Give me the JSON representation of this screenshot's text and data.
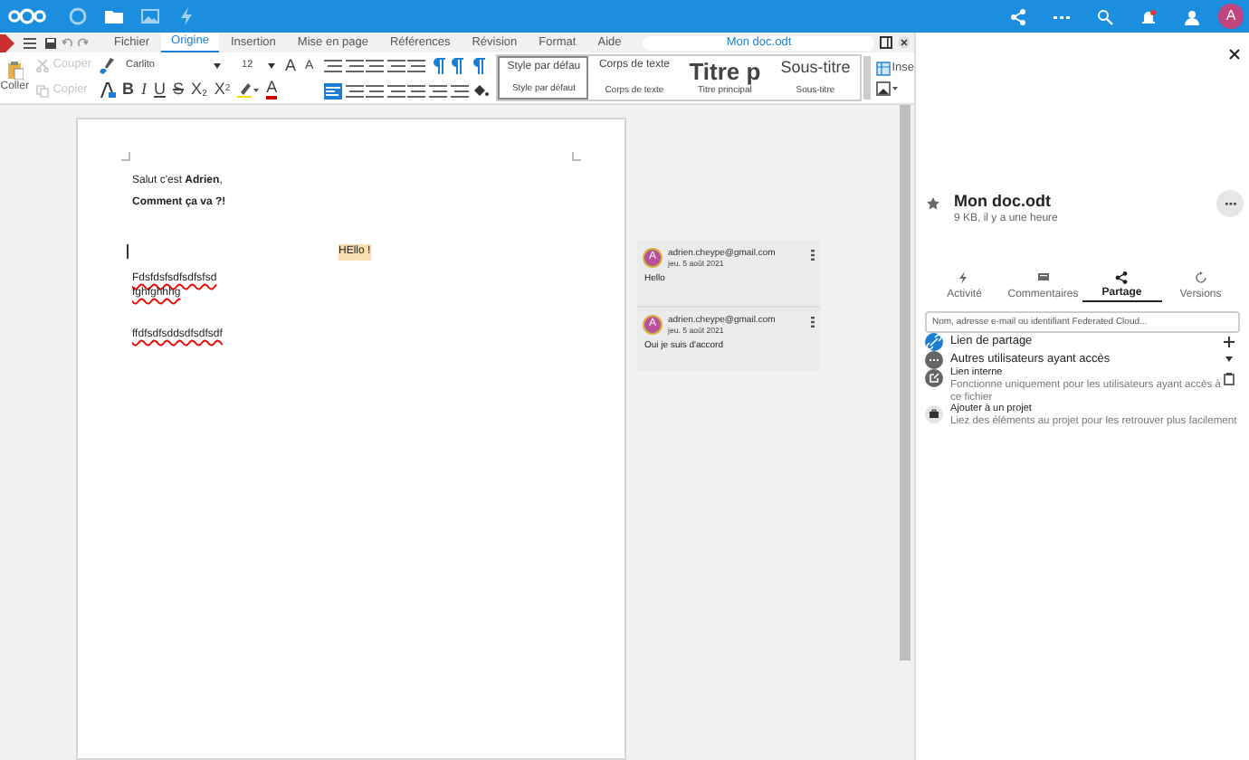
{
  "top_bar": {
    "apps": [
      {
        "kind": "circle",
        "selected": false
      },
      {
        "kind": "folder",
        "selected": true
      },
      {
        "kind": "image",
        "selected": false
      },
      {
        "kind": "activity",
        "selected": false
      }
    ],
    "avatar": "A"
  },
  "menu": {
    "tabs": [
      {
        "label": "Fichier",
        "selected": false
      },
      {
        "label": "Origine",
        "selected": true
      },
      {
        "label": "Insertion",
        "selected": false
      },
      {
        "label": "Mise en page",
        "selected": false
      },
      {
        "label": "Références",
        "selected": false
      },
      {
        "label": "Révision",
        "selected": false
      },
      {
        "label": "Format",
        "selected": false
      },
      {
        "label": "Aide",
        "selected": false
      }
    ],
    "document_title": "Mon doc.odt"
  },
  "toolbar": {
    "paste": "Coller",
    "cut": {
      "label": "Couper",
      "disabled": true
    },
    "copy": {
      "label": "Copier",
      "disabled": true
    },
    "font": "Carlito",
    "size": "12",
    "grow_font": "A",
    "shrink_font": "A",
    "format_buttons": [
      {
        "kind": "bold",
        "label": "B"
      },
      {
        "kind": "italic",
        "label": "I"
      },
      {
        "kind": "underline",
        "label": "U"
      },
      {
        "kind": "strike",
        "label": "S"
      },
      {
        "kind": "sub",
        "label": "X",
        "mark": "2"
      },
      {
        "kind": "sup",
        "label": "X",
        "mark": "2"
      }
    ],
    "font_color": "A",
    "styles": [
      {
        "kind": "default",
        "preview": "Style par défau",
        "label": "Style par défaut",
        "selected": true
      },
      {
        "kind": "body",
        "preview": "Corps de texte",
        "label": "Corps de texte",
        "selected": false
      },
      {
        "kind": "title",
        "preview": "Titre p",
        "label": "Titre principal",
        "selected": false
      },
      {
        "kind": "subtitle",
        "preview": "Sous-titre",
        "label": "Sous-titre",
        "selected": false
      }
    ],
    "insert": "Inse"
  },
  "document": {
    "paragraphs": [
      {
        "kind": "plain",
        "text": "Salut c'est **Adrien**,"
      },
      {
        "kind": "bold",
        "text": "Comment ça va ?!"
      },
      {
        "kind": "highlight",
        "text": "HEllo !"
      },
      {
        "kind": "misspelled",
        "lines": [
          "Fdsfdsfsdfsdfsfsd",
          "fghfghhhg"
        ]
      },
      {
        "kind": "misspelled",
        "lines": [
          "ffdfsdfsddsdfsdfsdf"
        ]
      }
    ]
  },
  "comments": [
    {
      "avatar": "A",
      "author": "adrien.cheype@gmail.com",
      "date": "jeu. 5 août 2021",
      "text": "Hello"
    },
    {
      "avatar": "A",
      "author": "adrien.cheype@gmail.com",
      "date": "jeu. 5 août 2021",
      "text": "Oui je suis d'accord"
    }
  ],
  "sidebar": {
    "title": "Mon doc.odt",
    "favorite": false,
    "meta": "9 KB, il y a une heure",
    "tabs": [
      {
        "kind": "activity",
        "label": "Activité",
        "selected": false
      },
      {
        "kind": "comments",
        "label": "Commentaires",
        "selected": false
      },
      {
        "kind": "share",
        "label": "Partage",
        "selected": true
      },
      {
        "kind": "versions",
        "label": "Versions",
        "selected": false
      }
    ],
    "search_placeholder": "Nom, adresse e-mail ou identifiant Federated Cloud...",
    "rows": [
      {
        "kind": "share-link",
        "title": "Lien de partage"
      },
      {
        "kind": "others",
        "title": "Autres utilisateurs ayant accès"
      },
      {
        "kind": "internal",
        "title": "Lien interne",
        "subtitle": "Fonctionne uniquement pour les utilisateurs ayant accès à ce fichier"
      },
      {
        "kind": "project",
        "title": "Ajouter à un projet",
        "subtitle": "Liez des éléments au projet pour les retrouver plus facilement"
      }
    ]
  }
}
